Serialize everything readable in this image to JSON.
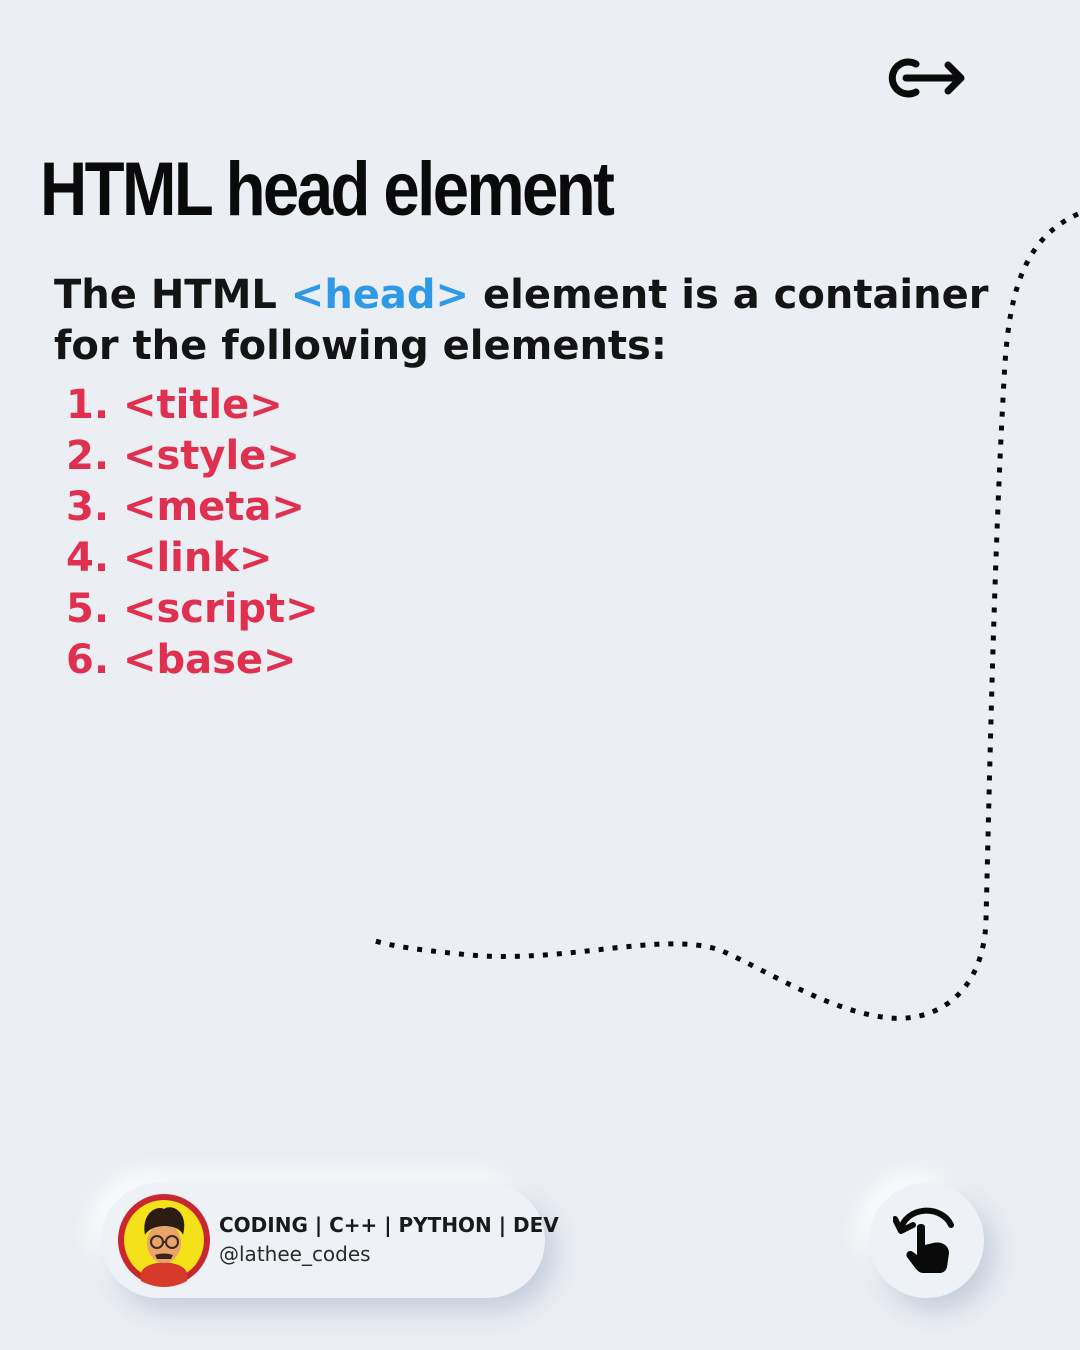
{
  "header": {
    "icon": "login-arrow-icon"
  },
  "title": "HTML head element",
  "intro": {
    "before": "The HTML ",
    "code": "<head>",
    "after": " element is a container for the following elements:"
  },
  "elements": [
    "1. <title>",
    "2. <style>",
    "3. <meta>",
    "4. <link>",
    "5. <script>",
    "6. <base>"
  ],
  "profile": {
    "tagline": "CODING | C++ | PYTHON | DEV",
    "handle": "@lathee_codes",
    "avatar_icon": "cartoon-avatar-icon"
  },
  "swipe_button": {
    "icon": "swipe-hand-icon"
  },
  "colors": {
    "background": "#ebeef3",
    "code_blue": "#2e9ae6",
    "list_red": "#e0304f",
    "text": "#141414"
  }
}
